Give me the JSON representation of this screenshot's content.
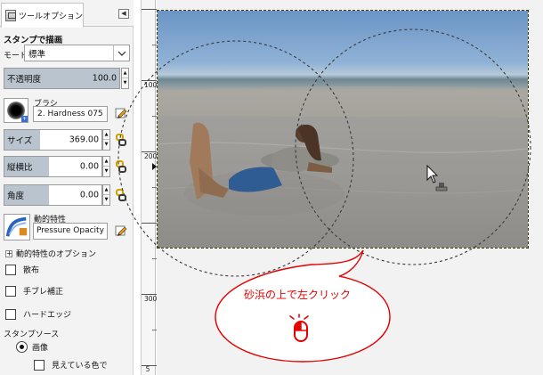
{
  "panel": {
    "tab_label": "ツールオプション",
    "section_title": "スタンプで描画",
    "mode_label": "モード:",
    "mode_value": "標準",
    "opacity": {
      "label": "不透明度",
      "value": "100.0",
      "fraction": 1.0
    },
    "brush": {
      "label": "ブラシ",
      "name": "2. Hardness 075"
    },
    "size": {
      "label": "サイズ",
      "value": "369.00",
      "fraction": 0.37
    },
    "aspect": {
      "label": "縦横比",
      "value": "0.00",
      "fraction": 0.5
    },
    "angle": {
      "label": "角度",
      "value": "0.00",
      "fraction": 0.5
    },
    "dynamics": {
      "label": "動的特性",
      "name": "Pressure Opacity"
    },
    "dynamics_options": "動的特性のオプション",
    "checks": [
      "散布",
      "手ブレ補正",
      "ハードエッジ"
    ],
    "source": {
      "title": "スタンプソース",
      "option": "画像",
      "sub_check": "見えている色で"
    }
  },
  "ruler": {
    "labels": [
      "100",
      "200",
      "300"
    ],
    "tail": "5"
  },
  "callout": {
    "text": "砂浜の上で左クリック"
  },
  "colors": {
    "accent_red": "#e60000",
    "marquee": "#e6e600",
    "slider_fill": "#b9c4cf"
  },
  "icons": [
    "tool-options-icon",
    "panel-menu-icon",
    "dropdown-arrow-icon",
    "chain-link-icon",
    "edit-pencil-icon",
    "dynamics-icon",
    "mouse-left-click-icon",
    "clone-cursor-icon"
  ]
}
